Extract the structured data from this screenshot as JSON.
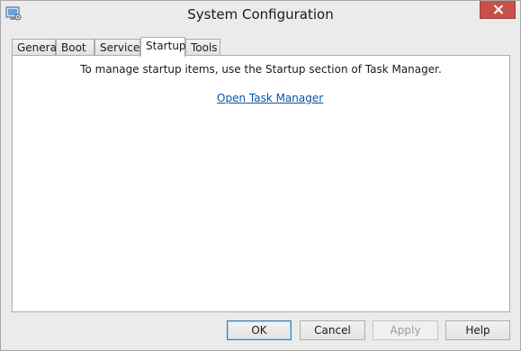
{
  "window": {
    "title": "System Configuration"
  },
  "tabs": [
    {
      "label": "General"
    },
    {
      "label": "Boot"
    },
    {
      "label": "Services"
    },
    {
      "label": "Startup"
    },
    {
      "label": "Tools"
    }
  ],
  "active_tab": "Startup",
  "startup_panel": {
    "message": "To manage startup items, use the Startup section of Task Manager.",
    "link_label": "Open Task Manager"
  },
  "buttons": {
    "ok": "OK",
    "cancel": "Cancel",
    "apply": "Apply",
    "help": "Help"
  },
  "colors": {
    "close_button": "#c7504b",
    "link": "#0c54a3",
    "default_button_border": "#3c7fb1"
  },
  "icons": {
    "app": "system-config-icon",
    "close": "close-icon"
  }
}
